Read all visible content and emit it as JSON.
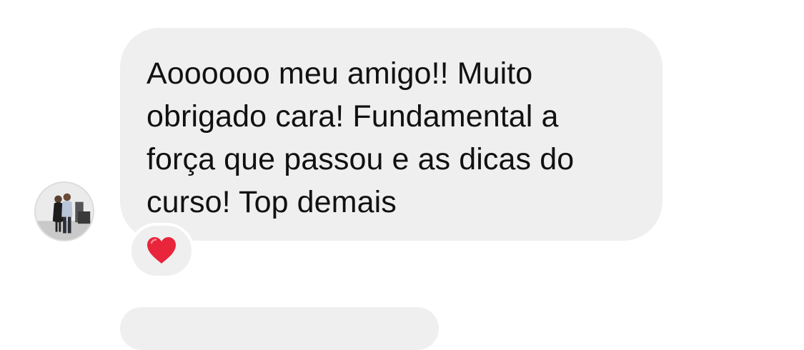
{
  "message": {
    "text": "Aoooooo meu amigo!! Muito obrigado cara! Fundamental a força que passou e as dicas do curso! Top demais"
  },
  "sender": {
    "avatar_icon": "profile-photo"
  },
  "reaction": {
    "icon": "heart-icon",
    "color": "#e8253b"
  },
  "colors": {
    "bubble_bg": "#efefef",
    "page_bg": "#ffffff",
    "text": "#111111"
  }
}
